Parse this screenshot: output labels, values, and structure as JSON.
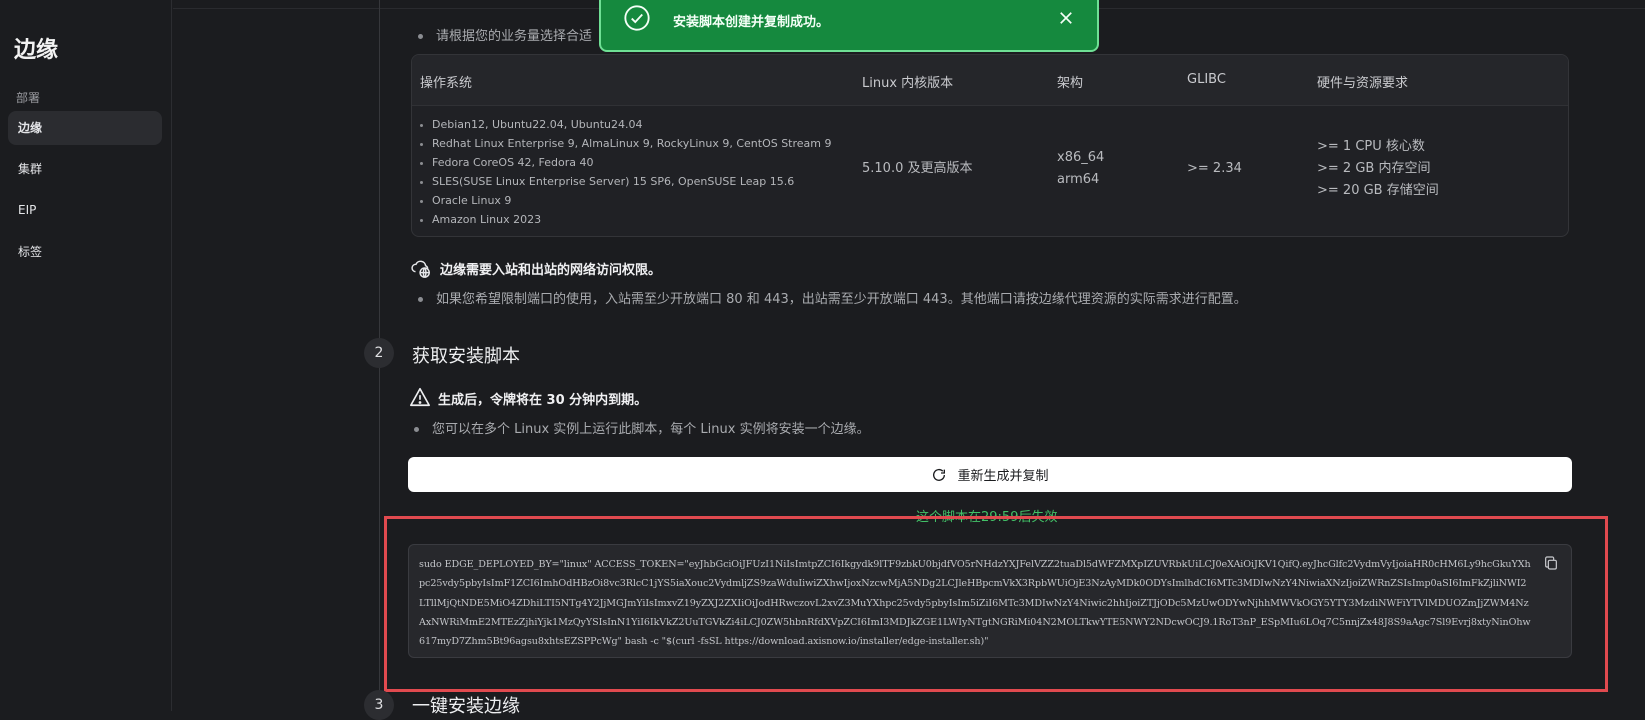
{
  "sidebar": {
    "title": "边缘",
    "section": "部署",
    "items": [
      {
        "label": "边缘",
        "active": true
      },
      {
        "label": "集群"
      },
      {
        "label": "EIP"
      },
      {
        "label": "标签"
      }
    ]
  },
  "requirements": {
    "intro": "请根据您的业务量选择合适",
    "headers": {
      "os": "操作系统",
      "kernel": "Linux 内核版本",
      "arch": "架构",
      "glibc": "GLIBC",
      "hardware": "硬件与资源要求"
    },
    "os_list": [
      "Debian12, Ubuntu22.04, Ubuntu24.04",
      "Redhat Linux Enterprise 9, AlmaLinux 9, RockyLinux 9, CentOS Stream 9",
      "Fedora CoreOS 42, Fedora 40",
      "SLES(SUSE Linux Enterprise Server) 15 SP6, OpenSUSE Leap 15.6",
      "Oracle Linux 9",
      "Amazon Linux 2023"
    ],
    "kernel": "5.10.0 及更高版本",
    "arch": [
      "x86_64",
      "arm64"
    ],
    "glibc": ">= 2.34",
    "hardware": [
      ">= 1 CPU 核心数",
      ">= 2 GB 内存空间",
      ">= 20 GB 存储空间"
    ]
  },
  "network": {
    "title": "边缘需要入站和出站的网络访问权限。",
    "bullet": "如果您希望限制端口的使用，入站需至少开放端口 80 和 443，出站需至少开放端口 443。其他端口请按边缘代理资源的实际需求进行配置。"
  },
  "step2": {
    "number": "2",
    "title": "获取安装脚本",
    "warning": "生成后，令牌将在 30 分钟内到期。",
    "bullet": "您可以在多个 Linux 实例上运行此脚本，每个 Linux 实例将安装一个边缘。",
    "regen_button": "重新生成并复制",
    "expire": "这个脚本在29:59后失效",
    "script": "sudo EDGE_DEPLOYED_BY=\"linux\" ACCESS_TOKEN=\"eyJhbGciOiJFUzI1NiIsImtpZCI6Ikgydk9lTF9zbkU0bjdfVO5rNHdzYXJFelVZZ2tuaDl5dWFZMXpIZUVRbkUiLCJ0eXAiOiJKV1QifQ.eyJhcGlfc2VydmVyIjoiaHR0cHM6Ly9hcGkuYXhpc25vdy5pbyIsImF1ZCI6ImhOdHBzOi8vc3RlcC1jYS5iaXouc2VydmljZS9zaWduIiwiZXhwIjoxNzcwMjA5NDg2LCJleHBpcmVkX3RpbWUiOjE3NzAyMDk0ODYsImlhdCI6MTc3MDIwNzY4NiwiaXNzIjoiZWRnZSIsImp0aSI6ImFkZjliNWI2LTllMjQtNDE5MiO4ZDhiLTI5NTg4Y2JjMGJmYiIsImxvZ19yZXJ2ZXIiOiJodHRwczovL2xvZ3MuYXhpc25vdy5pbyIsIm5iZiI6MTc3MDIwNzY4Niwic2hhIjoiZTJjODc5MzUwODYwNjhhMWVkOGY5YTY3MzdiNWFiYTVlMDUOZmJjZWM4NzAxNWRiMmE2MTEzZjhiYjk1MzQyYSIsInN1YiI6IkVkZ2UuTGVkZi4iLCJ0ZW5hbnRfdXVpZCI6ImI3MDJkZGE1LWIyNTgtNGRiMi04N2MOLTkwYTE5NWY2NDcwOCJ9.1RoT3nP_ESpMIu6LOq7C5nnjZx48J8S9aAgc7Sl9Evrj8xtyNinOhw617myD7Zhm5Bt96agsu8xhtsEZSPPcWg\" bash -c \"$(curl -fsSL https://download.axisnow.io/installer/edge-installer.sh)\""
  },
  "step3": {
    "number": "3",
    "title": "一键安装边缘"
  },
  "toast": {
    "message": "安装脚本创建并复制成功。"
  },
  "colors": {
    "toast_bg": "#15893e",
    "highlight": "#e14a4f",
    "expire_text": "#42c167"
  }
}
